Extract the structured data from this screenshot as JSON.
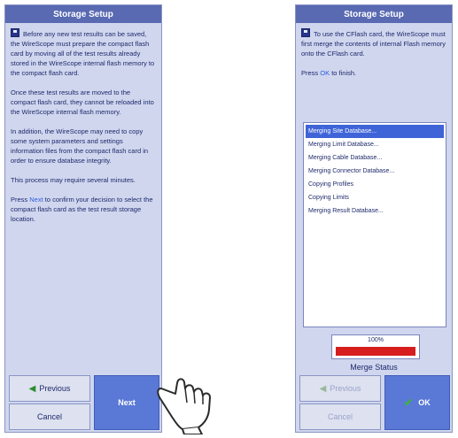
{
  "left_panel": {
    "title": "Storage Setup",
    "para1": "Before any new test results can be saved, the WireScope must prepare the compact flash card by moving all of the test results already stored in the WireScope internal flash memory to the compact flash card.",
    "para2": "Once these test results are moved to the compact flash card, they cannot be reloaded into the WireScope internal flash memory.",
    "para3": "In addition, the WireScope may need to copy some system parameters and settings information files from the compact flash card in order to ensure database integrity.",
    "para4": "This process may require several minutes.",
    "para5_pre": "Press ",
    "para5_key": "Next",
    "para5_post": " to confirm your decision to select the compact flash card as the test result storage location.",
    "previous_label": "Previous",
    "cancel_label": "Cancel",
    "next_label": "Next"
  },
  "right_panel": {
    "title": "Storage Setup",
    "intro": "To use the CFlash card, the WireScope must first merge the contents of internal Flash memory onto the CFlash card.",
    "press_pre": "Press ",
    "press_key": "OK",
    "press_post": " to finish.",
    "list_items": [
      "Merging Site Database...",
      "Merging Limit Database...",
      "Merging Cable Database...",
      "Merging Connector Database...",
      "Copying Profiles",
      "Copying Limits",
      "Merging Result Database..."
    ],
    "progress_text": "100%",
    "progress_value": 1.0,
    "status_label": "Merge Status",
    "previous_label": "Previous",
    "cancel_label": "Cancel",
    "ok_label": "OK"
  },
  "icons": {
    "disk": "floppy-disk-icon",
    "hand": "pointing-hand-icon",
    "back": "back-arrow-icon",
    "check": "check-icon"
  },
  "colors": {
    "title_bar": "#5969b2",
    "panel_bg": "#cfd6ee",
    "primary_button": "#5a79d6",
    "progress_fill": "#d61e1e",
    "selected_item": "#3e64d8"
  }
}
